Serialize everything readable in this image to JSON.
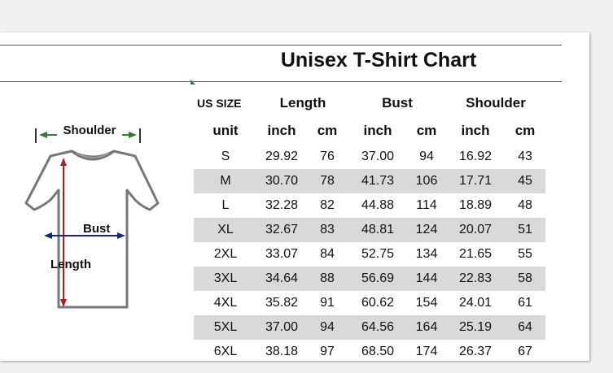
{
  "chart": {
    "title": "Unisex T-Shirt Chart",
    "us_size_label": "US SIZE",
    "unit_label": "unit",
    "columns": [
      {
        "group": "Length",
        "units": [
          "inch",
          "cm"
        ]
      },
      {
        "group": "Bust",
        "units": [
          "inch",
          "cm"
        ]
      },
      {
        "group": "Shoulder",
        "units": [
          "inch",
          "cm"
        ]
      }
    ],
    "rows": [
      [
        "S",
        "29.92",
        "76",
        "37.00",
        "94",
        "16.92",
        "43"
      ],
      [
        "M",
        "30.70",
        "78",
        "41.73",
        "106",
        "17.71",
        "45"
      ],
      [
        "L",
        "32.28",
        "82",
        "44.88",
        "114",
        "18.89",
        "48"
      ],
      [
        "XL",
        "32.67",
        "83",
        "48.81",
        "124",
        "20.07",
        "51"
      ],
      [
        "2XL",
        "33.07",
        "84",
        "52.75",
        "134",
        "21.65",
        "55"
      ],
      [
        "3XL",
        "34.64",
        "88",
        "56.69",
        "144",
        "22.83",
        "58"
      ],
      [
        "4XL",
        "35.82",
        "91",
        "60.62",
        "154",
        "24.01",
        "61"
      ],
      [
        "5XL",
        "37.00",
        "94",
        "64.56",
        "164",
        "25.19",
        "64"
      ],
      [
        "6XL",
        "38.18",
        "97",
        "68.50",
        "174",
        "26.37",
        "67"
      ]
    ]
  },
  "diagram": {
    "shoulder_label": "Shoulder",
    "bust_label": "Bust",
    "length_label": "Length",
    "shoulder_arrow_color": "#2e7d32",
    "bust_arrow_color": "#1a237e",
    "length_arrow_color": "#b71c1c"
  }
}
